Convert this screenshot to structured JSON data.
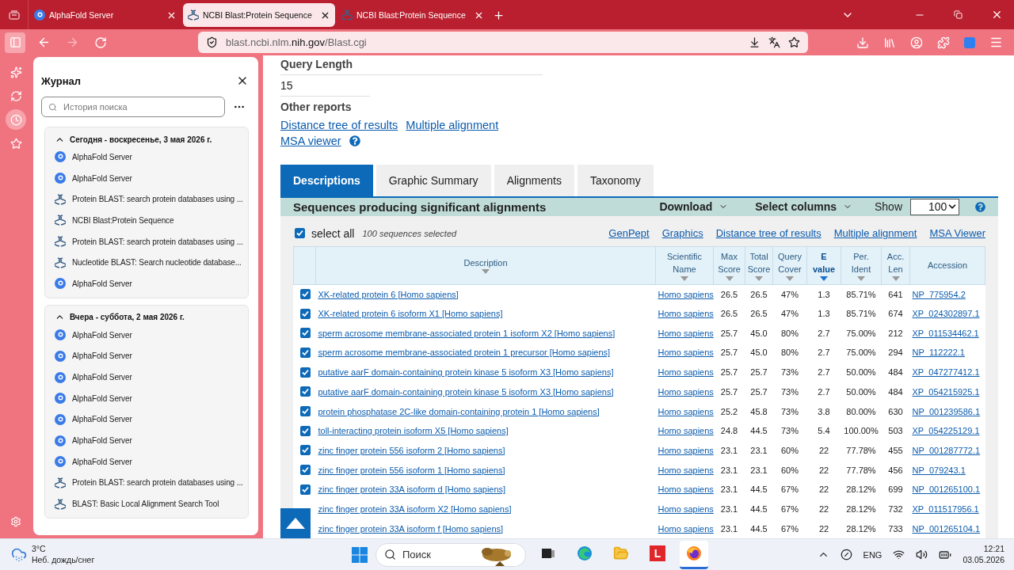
{
  "browser_tabs": [
    {
      "title": "AlphaFold Server",
      "kind": "alphafold",
      "selected": false
    },
    {
      "title": "NCBI Blast:Protein Sequence",
      "kind": "ncbi",
      "selected": true
    },
    {
      "title": "NCBI Blast:Protein Sequence",
      "kind": "ncbi",
      "selected": false
    }
  ],
  "nav_buttons": [
    {
      "kind": "back",
      "disabled": false
    },
    {
      "kind": "forward",
      "disabled": true
    },
    {
      "kind": "reload",
      "disabled": false
    }
  ],
  "address": "blast.ncbi.nlm.**nih.gov**/Blast.cgi",
  "side_strip": [
    {
      "kind": "sparkle",
      "selected": false
    },
    {
      "kind": "sync",
      "selected": false
    },
    {
      "kind": "history",
      "selected": true
    },
    {
      "kind": "bookmarks",
      "selected": false
    }
  ],
  "history_panel": {
    "title": "Журнал",
    "search": {
      "placeholder": "История поиска"
    },
    "groups": [
      {
        "title": "Сегодня - воскресенье, 3 мая 2026 г.",
        "expanded": true,
        "items": [
          {
            "title": "AlphaFold Server",
            "kind": "alphafold"
          },
          {
            "title": "AlphaFold Server",
            "kind": "alphafold"
          },
          {
            "title": "Protein BLAST: search protein databases using ...",
            "kind": "ncbi"
          },
          {
            "title": "NCBI Blast:Protein Sequence",
            "kind": "ncbi"
          },
          {
            "title": "Protein BLAST: search protein databases using ...",
            "kind": "ncbi"
          },
          {
            "title": "Nucleotide BLAST: Search nucleotide database...",
            "kind": "ncbi"
          },
          {
            "title": "AlphaFold Server",
            "kind": "alphafold"
          }
        ]
      },
      {
        "title": "Вчера - суббота, 2 мая 2026 г.",
        "expanded": true,
        "items": [
          {
            "title": "AlphaFold Server",
            "kind": "alphafold"
          },
          {
            "title": "AlphaFold Server",
            "kind": "alphafold"
          },
          {
            "title": "AlphaFold Server",
            "kind": "alphafold"
          },
          {
            "title": "AlphaFold Server",
            "kind": "alphafold"
          },
          {
            "title": "AlphaFold Server",
            "kind": "alphafold"
          },
          {
            "title": "AlphaFold Server",
            "kind": "alphafold"
          },
          {
            "title": "AlphaFold Server",
            "kind": "alphafold"
          },
          {
            "title": "Protein BLAST: search protein databases using ...",
            "kind": "ncbi"
          },
          {
            "title": "BLAST: Basic Local Alignment Search Tool",
            "kind": "ncbi"
          }
        ]
      }
    ]
  },
  "query_length": {
    "label": "Query Length",
    "value": "15"
  },
  "other_reports": {
    "label": "Other reports",
    "links": [
      "Distance tree of results",
      "Multiple alignment",
      "MSA viewer"
    ]
  },
  "result_tabs": [
    {
      "label": "Descriptions",
      "selected": true
    },
    {
      "label": "Graphic Summary",
      "selected": false
    },
    {
      "label": "Alignments",
      "selected": false
    },
    {
      "label": "Taxonomy",
      "selected": false
    }
  ],
  "results": {
    "title": "Sequences producing significant alignments",
    "download": "Download",
    "select_columns": "Select columns",
    "show_label": "Show",
    "show_value": "100",
    "select_all": {
      "label": "select all",
      "checked": true,
      "count": "100 sequences selected"
    },
    "links": [
      "GenPept",
      "Graphics",
      "Distance tree of results",
      "Multiple alignment",
      "MSA Viewer"
    ],
    "columns": [
      {
        "label": "Description",
        "sortable": true,
        "sorted": false
      },
      {
        "label": "Scientific Name",
        "sortable": true,
        "sorted": false
      },
      {
        "label": "Max Score",
        "sortable": true,
        "sorted": false
      },
      {
        "label": "Total Score",
        "sortable": true,
        "sorted": false
      },
      {
        "label": "Query Cover",
        "sortable": true,
        "sorted": false
      },
      {
        "label": "E value",
        "sortable": true,
        "sorted": true
      },
      {
        "label": "Per. Ident",
        "sortable": true,
        "sorted": false
      },
      {
        "label": "Acc. Len",
        "sortable": true,
        "sorted": false
      },
      {
        "label": "Accession",
        "sortable": false,
        "sorted": false
      }
    ],
    "rows": [
      {
        "checked": true,
        "description": "XK-related protein 6 [Homo sapiens]",
        "scientific_name": "Homo sapiens",
        "max_score": "26.5",
        "total_score": "26.5",
        "query_cover": "47%",
        "e_value": "1.3",
        "per_ident": "85.71%",
        "acc_len": "641",
        "accession": "NP_775954.2"
      },
      {
        "checked": true,
        "description": "XK-related protein 6 isoform X1 [Homo sapiens]",
        "scientific_name": "Homo sapiens",
        "max_score": "26.5",
        "total_score": "26.5",
        "query_cover": "47%",
        "e_value": "1.3",
        "per_ident": "85.71%",
        "acc_len": "674",
        "accession": "XP_024302897.1"
      },
      {
        "checked": true,
        "description": "sperm acrosome membrane-associated protein 1 isoform X2 [Homo sapiens]",
        "scientific_name": "Homo sapiens",
        "max_score": "25.7",
        "total_score": "45.0",
        "query_cover": "80%",
        "e_value": "2.7",
        "per_ident": "75.00%",
        "acc_len": "212",
        "accession": "XP_011534462.1"
      },
      {
        "checked": true,
        "description": "sperm acrosome membrane-associated protein 1 precursor [Homo sapiens]",
        "scientific_name": "Homo sapiens",
        "max_score": "25.7",
        "total_score": "45.0",
        "query_cover": "80%",
        "e_value": "2.7",
        "per_ident": "75.00%",
        "acc_len": "294",
        "accession": "NP_112222.1"
      },
      {
        "checked": true,
        "description": "putative aarF domain-containing protein kinase 5 isoform X3 [Homo sapiens]",
        "scientific_name": "Homo sapiens",
        "max_score": "25.7",
        "total_score": "25.7",
        "query_cover": "73%",
        "e_value": "2.7",
        "per_ident": "50.00%",
        "acc_len": "484",
        "accession": "XP_047277412.1"
      },
      {
        "checked": true,
        "description": "putative aarF domain-containing protein kinase 5 isoform X3 [Homo sapiens]",
        "scientific_name": "Homo sapiens",
        "max_score": "25.7",
        "total_score": "25.7",
        "query_cover": "73%",
        "e_value": "2.7",
        "per_ident": "50.00%",
        "acc_len": "484",
        "accession": "XP_054215925.1"
      },
      {
        "checked": true,
        "description": "protein phosphatase 2C-like domain-containing protein 1 [Homo sapiens]",
        "scientific_name": "Homo sapiens",
        "max_score": "25.2",
        "total_score": "45.8",
        "query_cover": "73%",
        "e_value": "3.8",
        "per_ident": "80.00%",
        "acc_len": "630",
        "accession": "NP_001239586.1"
      },
      {
        "checked": true,
        "description": "toll-interacting protein isoform X5 [Homo sapiens]",
        "scientific_name": "Homo sapiens",
        "max_score": "24.8",
        "total_score": "44.5",
        "query_cover": "73%",
        "e_value": "5.4",
        "per_ident": "100.00%",
        "acc_len": "503",
        "accession": "XP_054225129.1"
      },
      {
        "checked": true,
        "description": "zinc finger protein 556 isoform 2 [Homo sapiens]",
        "scientific_name": "Homo sapiens",
        "max_score": "23.1",
        "total_score": "23.1",
        "query_cover": "60%",
        "e_value": "22",
        "per_ident": "77.78%",
        "acc_len": "455",
        "accession": "NP_001287772.1"
      },
      {
        "checked": true,
        "description": "zinc finger protein 556 isoform 1 [Homo sapiens]",
        "scientific_name": "Homo sapiens",
        "max_score": "23.1",
        "total_score": "23.1",
        "query_cover": "60%",
        "e_value": "22",
        "per_ident": "77.78%",
        "acc_len": "456",
        "accession": "NP_079243.1"
      },
      {
        "checked": true,
        "description": "zinc finger protein 33A isoform d [Homo sapiens]",
        "scientific_name": "Homo sapiens",
        "max_score": "23.1",
        "total_score": "44.5",
        "query_cover": "67%",
        "e_value": "22",
        "per_ident": "28.12%",
        "acc_len": "699",
        "accession": "NP_001265100.1"
      },
      {
        "description": "zinc finger protein 33A isoform X2 [Homo sapiens]",
        "scientific_name": "Homo sapiens",
        "max_score": "23.1",
        "total_score": "44.5",
        "query_cover": "67%",
        "e_value": "22",
        "per_ident": "28.12%",
        "acc_len": "732",
        "accession": "XP_011517956.1"
      },
      {
        "description": "zinc finger protein 33A isoform f [Homo sapiens]",
        "scientific_name": "Homo sapiens",
        "max_score": "23.1",
        "total_score": "44.5",
        "query_cover": "67%",
        "e_value": "22",
        "per_ident": "28.12%",
        "acc_len": "733",
        "accession": "NP_001265104.1"
      }
    ]
  },
  "taskbar": {
    "weather": {
      "temperature": "3°C",
      "condition": "Неб. дождь/снег"
    },
    "search_placeholder": "Поиск",
    "apps": [
      {
        "kind": "taskview",
        "selected": false
      },
      {
        "kind": "edge",
        "selected": false
      },
      {
        "kind": "files",
        "selected": false
      },
      {
        "kind": "letter",
        "label": "L",
        "selected": false
      },
      {
        "kind": "firefox",
        "selected": true
      }
    ],
    "language": "ENG",
    "time": "12:21",
    "date": "03.05.2026"
  }
}
